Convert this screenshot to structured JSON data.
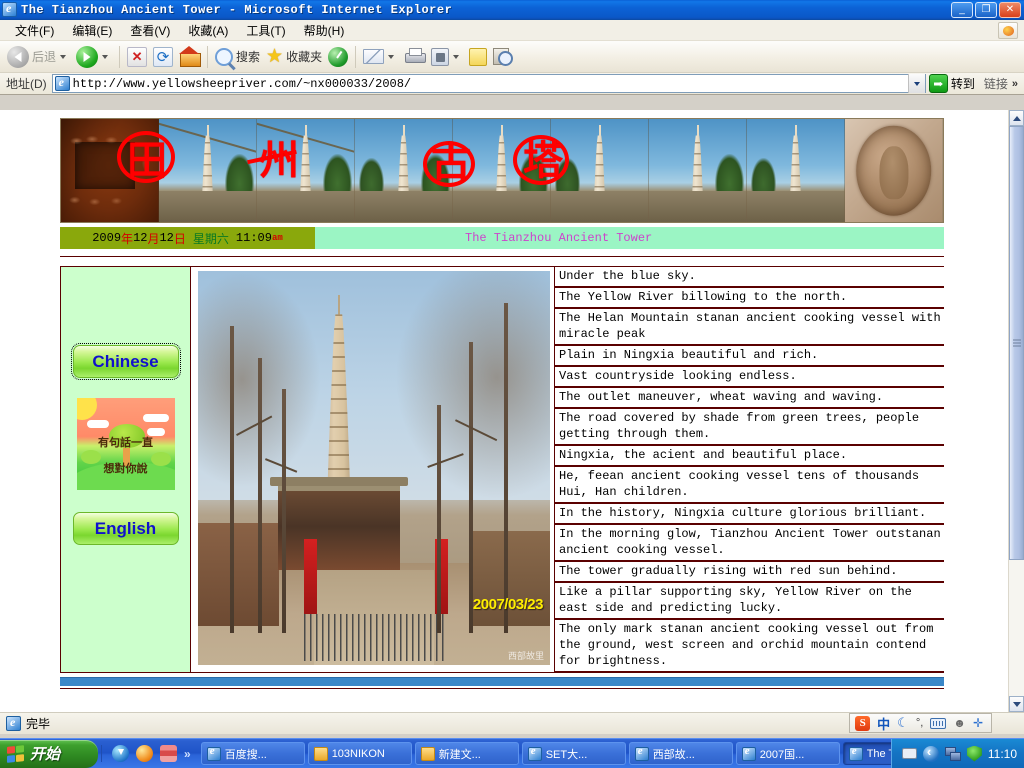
{
  "window": {
    "title": "The Tianzhou Ancient Tower - Microsoft Internet Explorer",
    "minimize_label": "_",
    "restore_label": "❐",
    "close_label": "✕"
  },
  "menu": {
    "items": [
      {
        "label": "文件(F)"
      },
      {
        "label": "编辑(E)"
      },
      {
        "label": "查看(V)"
      },
      {
        "label": "收藏(A)"
      },
      {
        "label": "工具(T)"
      },
      {
        "label": "帮助(H)"
      }
    ]
  },
  "toolbar": {
    "back_label": "后退",
    "forward_label": "",
    "stop_label": "",
    "refresh_label": "",
    "home_label": "",
    "search_label": "搜索",
    "favorites_label": "收藏夹",
    "history_label": "",
    "mail_label": "",
    "print_label": "",
    "edit_label": "",
    "note_label": "",
    "messenger_label": ""
  },
  "address_bar": {
    "label": "地址(D)",
    "url": "http://www.yellowsheepriver.com/~nx000033/2008/",
    "go_label": "转到",
    "links_label": "链接",
    "more_label": "»"
  },
  "page": {
    "banner": {
      "calligraphy": [
        "田",
        "州",
        "古",
        "塔"
      ]
    },
    "datebar": {
      "year": "2009",
      "year_cn": "年",
      "month": "12",
      "month_cn": "月",
      "day": "12",
      "day_cn": "日",
      "weekday": "星期六",
      "time": "11:09",
      "ampm": "am",
      "title": "The Tianzhou Ancient Tower"
    },
    "sidebar": {
      "chinese_label": "Chinese",
      "english_label": "English",
      "promo_line1": "有句話一直",
      "promo_line2": "想對你說"
    },
    "photo": {
      "timestamp": "2007/03/23",
      "watermark": "西部故里"
    },
    "verses": [
      "Under the blue sky.",
      "The Yellow River billowing to the north.",
      "The Helan Mountain stanan ancient cooking vessel with miracle peak",
      "Plain in Ningxia beautiful and rich.",
      "Vast countryside looking endless.",
      "The outlet maneuver, wheat waving and waving.",
      "The road covered by shade from green trees, people getting through them.",
      "Ningxia, the acient and beautiful place.",
      "He, feean ancient cooking vessel tens of thousands Hui, Han children.",
      "In the history, Ningxia culture glorious brilliant.",
      "In the morning glow, Tianzhou Ancient Tower outstanan ancient cooking vessel.",
      "The tower gradually rising with red sun behind.",
      "Like a pillar supporting sky, Yellow River on the east side and predicting lucky.",
      "The only mark stanan ancient cooking vessel out from the ground, west screen and orchid mountain contend for brightness."
    ]
  },
  "status_bar": {
    "text": "完毕"
  },
  "ime": {
    "brand": "S",
    "mode": "中",
    "moon": "☾",
    "punct": "°,",
    "person": "☻",
    "wrench": "🔧"
  },
  "taskbar": {
    "start_label": "开始",
    "quicklaunch_more": "»",
    "tasks": [
      {
        "label": "百度搜...",
        "icon": "ie",
        "active": false
      },
      {
        "label": "103NIKON",
        "icon": "folder",
        "active": false
      },
      {
        "label": "新建文...",
        "icon": "folder",
        "active": false
      },
      {
        "label": "SET大...",
        "icon": "ie",
        "active": false
      },
      {
        "label": "西部故...",
        "icon": "ie",
        "active": false
      },
      {
        "label": "2007国...",
        "icon": "ie",
        "active": false
      },
      {
        "label": "The Ti...",
        "icon": "ie",
        "active": true
      }
    ],
    "clock": "11:10"
  },
  "colors": {
    "titlebar_blue": "#0c62d6",
    "datebar_olive": "#8aa80c",
    "datebar_mint": "#9bf5c4",
    "sidebar_green": "#ccffcc",
    "table_border": "#5a0000",
    "accent_magenta": "#cc44cc"
  }
}
